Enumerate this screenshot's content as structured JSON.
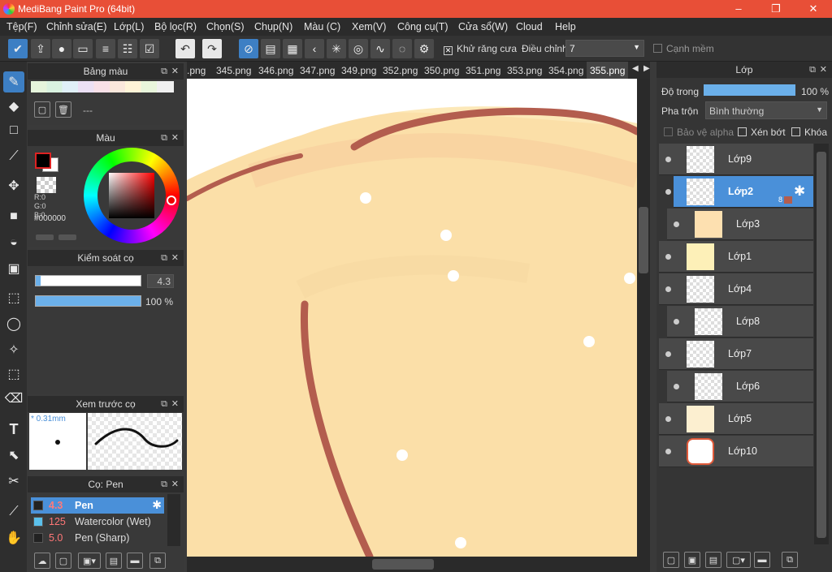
{
  "app": {
    "title": "MediBang Paint Pro (64bit)",
    "window_buttons": {
      "minimize": "–",
      "maximize": "❐",
      "close": "✕"
    }
  },
  "menu": [
    "Tệp(F)",
    "Chỉnh sửa(E)",
    "Lớp(L)",
    "Bộ lọc(R)",
    "Chọn(S)",
    "Chụp(N)",
    "Màu (C)",
    "Xem(V)",
    "Công cụ(T)",
    "Cửa sổ(W)",
    "Cloud",
    "Help"
  ],
  "toolbar": {
    "antialias_label": "Khử răng cưa",
    "adjust_label": "Điều chỉnh",
    "adjust_value": "7",
    "soft_edge_label": "Cạnh mềm"
  },
  "tabs": [
    ".png",
    "345.png",
    "346.png",
    "347.png",
    "349.png",
    "352.png",
    "350.png",
    "351.png",
    "353.png",
    "354.png",
    "355.png"
  ],
  "palette_panel": {
    "title": "Bảng màu",
    "placeholder": "---"
  },
  "color_panel": {
    "title": "Màu",
    "r": "R:0",
    "g": "G:0",
    "b": "B:0",
    "hex": "#000000"
  },
  "brush_control": {
    "title": "Kiểm soát cọ",
    "size": "4.3",
    "opacity": "100 %"
  },
  "brush_preview": {
    "title": "Xem trước cọ",
    "size_label": "* 0.31mm"
  },
  "brushes": {
    "title": "Cọ: Pen",
    "items": [
      {
        "size": "4.3",
        "name": "Pen",
        "color": "#222222"
      },
      {
        "size": "125",
        "name": "Watercolor (Wet)",
        "color": "#5bc0eb"
      },
      {
        "size": "5.0",
        "name": "Pen (Sharp)",
        "color": "#222222"
      }
    ]
  },
  "layer_panel": {
    "title": "Lớp",
    "opacity_label": "Độ trong",
    "opacity_value": "100 %",
    "blend_label": "Pha trộn",
    "blend_value": "Bình thường",
    "protect_alpha": "Bảo vệ alpha",
    "clipping": "Xén bớt",
    "lock": "Khóa",
    "selected_badge": "8",
    "layers": [
      "Lớp9",
      "Lớp2",
      "Lớp3",
      "Lớp1",
      "Lớp4",
      "Lớp8",
      "Lớp7",
      "Lớp6",
      "Lớp5",
      "Lớp10"
    ]
  },
  "colors": {
    "accent": "#3d7fc4",
    "title_bar": "#e84f37",
    "stroke": "#b35d4e",
    "canvas": "#fbe3b0"
  }
}
